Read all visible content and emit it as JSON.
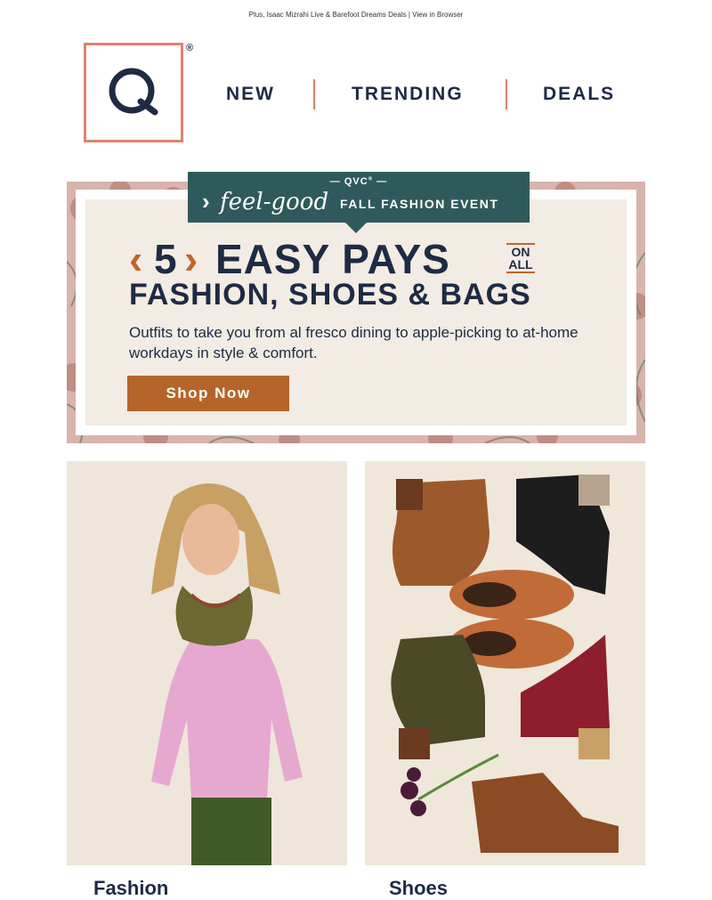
{
  "preheader": {
    "text": "Plus, Isaac Mizrahi Live & Barefoot Dreams Deals",
    "separator": " | ",
    "link": "View in Browser"
  },
  "logo": {
    "letter": "Q",
    "registered": "®"
  },
  "nav": {
    "items": [
      "NEW",
      "TRENDING",
      "DEALS"
    ]
  },
  "hero": {
    "brand": "QVC",
    "brand_mark": "®",
    "chevron": "›",
    "feel_good": "feel-good",
    "event_name": "FALL FASHION EVENT",
    "bracket_open": "‹",
    "bracket_close": "›",
    "number": "5",
    "headline": "EASY PAYS",
    "on": "ON",
    "all": "ALL",
    "subhead": "FASHION, SHOES & BAGS",
    "copy": "Outfits to take you from al fresco dining to apple-picking to at-home workdays in style & comfort.",
    "cta": "Shop Now"
  },
  "tiles": [
    {
      "label": "Fashion",
      "image": "woman-pink-top-scarf"
    },
    {
      "label": "Shoes",
      "image": "fall-boots-flatlay"
    }
  ],
  "colors": {
    "navy": "#1f2a44",
    "coral": "#e2806e",
    "teal": "#2f5a5b",
    "rust": "#b5652a",
    "cream": "#f2ece4"
  }
}
